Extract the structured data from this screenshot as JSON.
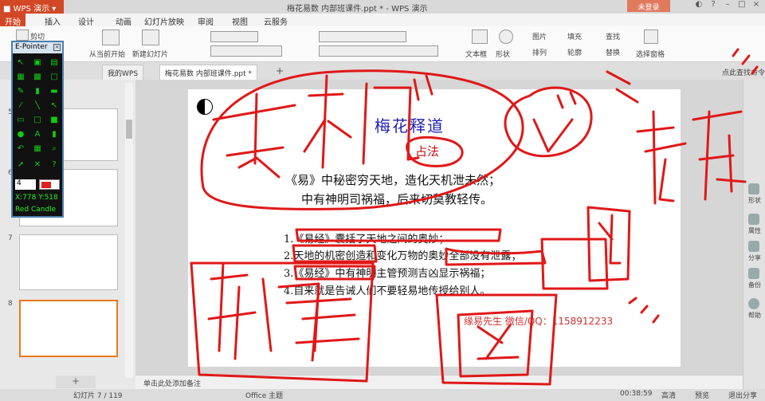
{
  "titlebar": {
    "app_name": "WPS 演示",
    "doc_title": "梅花易数 内部班课件.ppt * - WPS 演示",
    "login": "未登录"
  },
  "menu": {
    "tabs": [
      "开始",
      "插入",
      "设计",
      "动画",
      "幻灯片放映",
      "审阅",
      "视图",
      "云服务"
    ]
  },
  "ribbon": {
    "cut": "剪切",
    "new_slide_from_file": "从当前开始",
    "new_slide": "新建幻灯片",
    "textbox": "文本框",
    "shape": "形状",
    "picture": "图片",
    "fill": "填充",
    "arrange": "排列",
    "outline": "轮廓",
    "find": "查找",
    "replace": "替换",
    "select_pane": "选择窗格"
  },
  "tabs": [
    {
      "label": "我的WPS"
    },
    {
      "label": "梅花易数 内部班课件.ppt *"
    }
  ],
  "tab_right": "点此查找命令",
  "slides_pane": {
    "numbers": [
      "5",
      "6",
      "7",
      "8"
    ],
    "active": "7",
    "add_label": "+"
  },
  "epointer": {
    "title": "E-Pointer",
    "close": "×",
    "pen_size": "4",
    "coords": "X:778  Y:518",
    "color_name": "Red Candle",
    "color": "#e02020"
  },
  "slide": {
    "title": "梅花释道",
    "subtitle": "占法",
    "para1": "《易》中秘密穷天地，造化天机泄未然；",
    "para2": "中有神明司祸福，后来切莫教轻传。",
    "items": [
      "1.《易经》囊括了天地之间的奥妙；",
      "2.天地的机密创造和变化万物的奥妙全部没有泄露；",
      "3.《易经》中有神明主管预测吉凶显示祸福；",
      "4.自来就是告诫人们不要轻易地传授给别人。"
    ],
    "contact": "缘易先生 微信/QQ：1158912233"
  },
  "notes": {
    "placeholder": "单击此处添加备注"
  },
  "status": {
    "slide_pos": "幻灯片 7 / 119",
    "theme": "Office 主题",
    "time": "00:38:59",
    "zoom_label": "高清",
    "preview": "预览",
    "exit_share": "退出分享"
  },
  "right_panel": [
    "形状",
    "属性",
    "分享",
    "备份",
    "帮助"
  ],
  "ink_color": "#e01818"
}
